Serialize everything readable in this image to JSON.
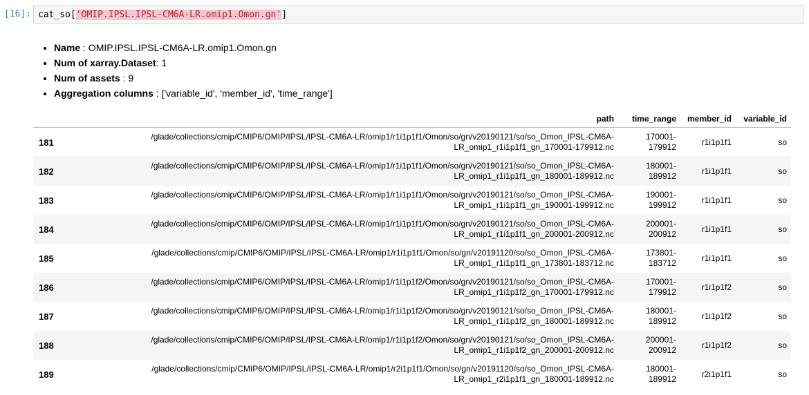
{
  "cell": {
    "prompt": "[16]:",
    "code_prefix": "cat_so[",
    "code_string": "'OMIP.IPSL.IPSL-CM6A-LR.omip1.Omon.gn'",
    "code_suffix": "]"
  },
  "info": {
    "name_label": "Name",
    "name_value": " : OMIP.IPSL.IPSL-CM6A-LR.omip1.Omon.gn",
    "datasets_label": "Num of xarray.Dataset",
    "datasets_value": ": 1",
    "assets_label": "Num of assets",
    "assets_value": " : 9",
    "agg_label": "Aggregation columns",
    "agg_value": " : ['variable_id', 'member_id', 'time_range']"
  },
  "table": {
    "headers": {
      "index": "",
      "path": "path",
      "time_range": "time_range",
      "member_id": "member_id",
      "variable_id": "variable_id"
    },
    "rows": [
      {
        "index": "181",
        "path1": "/glade/collections/cmip/CMIP6/OMIP/IPSL/IPSL-CM6A-LR/omip1/r1i1p1f1/Omon/so/gn/v20190121/so/so_Omon_IPSL-CM6A-",
        "path2": "LR_omip1_r1i1p1f1_gn_170001-179912.nc",
        "tr1": "170001-",
        "tr2": "179912",
        "member": "r1i1p1f1",
        "var": "so"
      },
      {
        "index": "182",
        "path1": "/glade/collections/cmip/CMIP6/OMIP/IPSL/IPSL-CM6A-LR/omip1/r1i1p1f1/Omon/so/gn/v20190121/so/so_Omon_IPSL-CM6A-",
        "path2": "LR_omip1_r1i1p1f1_gn_180001-189912.nc",
        "tr1": "180001-",
        "tr2": "189912",
        "member": "r1i1p1f1",
        "var": "so"
      },
      {
        "index": "183",
        "path1": "/glade/collections/cmip/CMIP6/OMIP/IPSL/IPSL-CM6A-LR/omip1/r1i1p1f1/Omon/so/gn/v20190121/so/so_Omon_IPSL-CM6A-",
        "path2": "LR_omip1_r1i1p1f1_gn_190001-199912.nc",
        "tr1": "190001-",
        "tr2": "199912",
        "member": "r1i1p1f1",
        "var": "so"
      },
      {
        "index": "184",
        "path1": "/glade/collections/cmip/CMIP6/OMIP/IPSL/IPSL-CM6A-LR/omip1/r1i1p1f1/Omon/so/gn/v20190121/so/so_Omon_IPSL-CM6A-",
        "path2": "LR_omip1_r1i1p1f1_gn_200001-200912.nc",
        "tr1": "200001-",
        "tr2": "200912",
        "member": "r1i1p1f1",
        "var": "so"
      },
      {
        "index": "185",
        "path1": "/glade/collections/cmip/CMIP6/OMIP/IPSL/IPSL-CM6A-LR/omip1/r1i1p1f1/Omon/so/gn/v20191120/so/so_Omon_IPSL-CM6A-",
        "path2": "LR_omip1_r1i1p1f1_gn_173801-183712.nc",
        "tr1": "173801-",
        "tr2": "183712",
        "member": "r1i1p1f1",
        "var": "so"
      },
      {
        "index": "186",
        "path1": "/glade/collections/cmip/CMIP6/OMIP/IPSL/IPSL-CM6A-LR/omip1/r1i1p1f2/Omon/so/gn/v20190121/so/so_Omon_IPSL-CM6A-",
        "path2": "LR_omip1_r1i1p1f2_gn_170001-179912.nc",
        "tr1": "170001-",
        "tr2": "179912",
        "member": "r1i1p1f2",
        "var": "so"
      },
      {
        "index": "187",
        "path1": "/glade/collections/cmip/CMIP6/OMIP/IPSL/IPSL-CM6A-LR/omip1/r1i1p1f2/Omon/so/gn/v20190121/so/so_Omon_IPSL-CM6A-",
        "path2": "LR_omip1_r1i1p1f2_gn_180001-189912.nc",
        "tr1": "180001-",
        "tr2": "189912",
        "member": "r1i1p1f2",
        "var": "so"
      },
      {
        "index": "188",
        "path1": "/glade/collections/cmip/CMIP6/OMIP/IPSL/IPSL-CM6A-LR/omip1/r1i1p1f2/Omon/so/gn/v20190121/so/so_Omon_IPSL-CM6A-",
        "path2": "LR_omip1_r1i1p1f2_gn_200001-200912.nc",
        "tr1": "200001-",
        "tr2": "200912",
        "member": "r1i1p1f2",
        "var": "so"
      },
      {
        "index": "189",
        "path1": "/glade/collections/cmip/CMIP6/OMIP/IPSL/IPSL-CM6A-LR/omip1/r2i1p1f1/Omon/so/gn/v20191120/so/so_Omon_IPSL-CM6A-",
        "path2": "LR_omip1_r2i1p1f1_gn_180001-189912.nc",
        "tr1": "180001-",
        "tr2": "189912",
        "member": "r2i1p1f1",
        "var": "so"
      }
    ]
  }
}
